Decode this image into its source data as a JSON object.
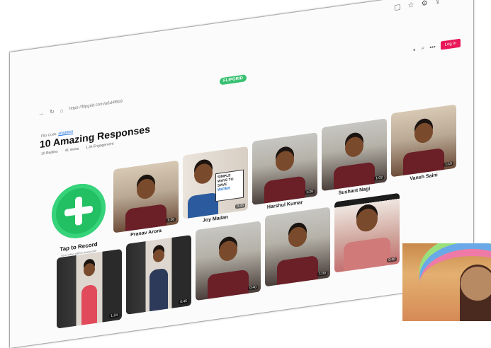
{
  "browser": {
    "url": "https://flipgrid.com/a6d4f6b9",
    "logo": "FLIPGRID",
    "login": "Log in"
  },
  "page": {
    "flip_code_label": "Flip Code: ",
    "flip_code_value": "a6d4f6b9",
    "title": "10 Amazing Responses",
    "stats": [
      "10 Replies",
      "41 views",
      "1.2k Engagement"
    ]
  },
  "record": {
    "label": "Tap to Record",
    "sub": "Your video will be awesome!"
  },
  "cards": [
    {
      "name": "Pranav Arora",
      "duration": "1:26"
    },
    {
      "name": "Joy Madan",
      "duration": "0:45",
      "sign": [
        "SIMPLE",
        "WAYS TO",
        "SAVE",
        "WATER"
      ]
    },
    {
      "name": "Harshul Kumar",
      "duration": "1:26"
    },
    {
      "name": "Sushant Nagi",
      "duration": "1:02"
    },
    {
      "name": "Vansh Saini",
      "duration": "1:15"
    },
    {
      "name": "",
      "duration": "1:24"
    },
    {
      "name": "",
      "duration": "0:45"
    },
    {
      "name": "",
      "duration": "0:40"
    },
    {
      "name": "",
      "duration": "1:00"
    },
    {
      "name": "",
      "duration": "0:40"
    }
  ]
}
